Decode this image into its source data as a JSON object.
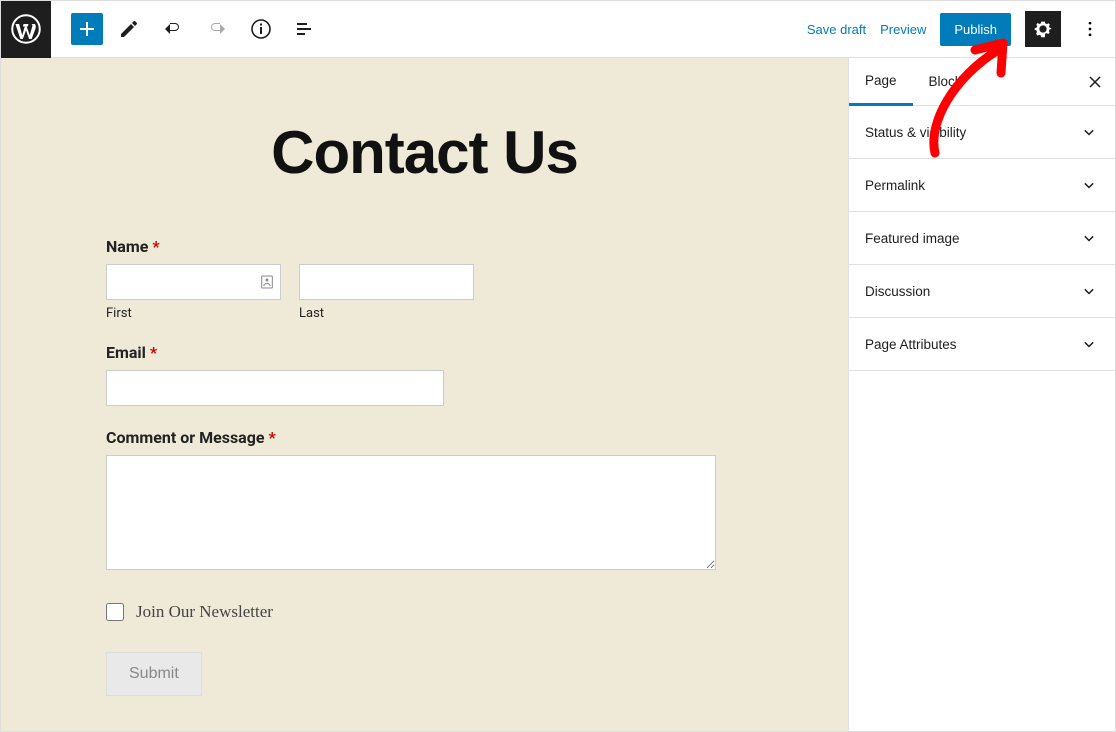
{
  "toolbar": {
    "save_draft": "Save draft",
    "preview": "Preview",
    "publish": "Publish"
  },
  "sidebar": {
    "tabs": {
      "page": "Page",
      "block": "Block"
    },
    "panels": {
      "status": "Status & visibility",
      "permalink": "Permalink",
      "featured": "Featured image",
      "discussion": "Discussion",
      "attributes": "Page Attributes"
    }
  },
  "page": {
    "title": "Contact Us"
  },
  "form": {
    "name_label": "Name",
    "first_sub": "First",
    "last_sub": "Last",
    "email_label": "Email",
    "comment_label": "Comment or Message",
    "newsletter_label": "Join Our Newsletter",
    "submit_label": "Submit",
    "required": "*"
  }
}
